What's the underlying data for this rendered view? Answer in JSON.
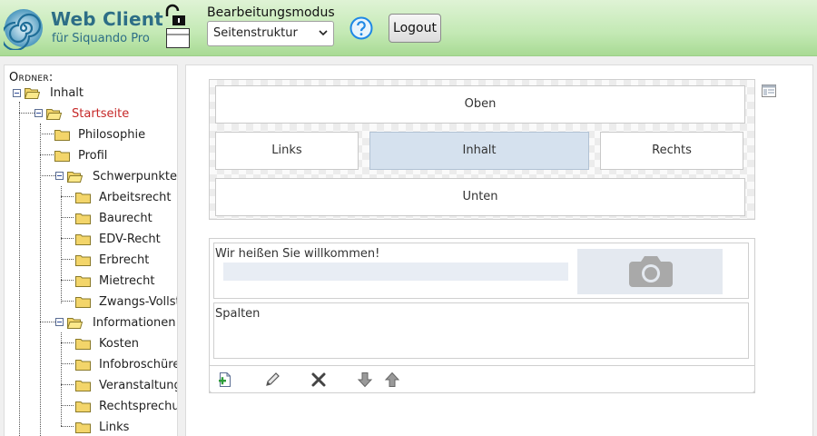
{
  "header": {
    "app_title": "Web Client",
    "app_subtitle": "für Siquando Pro",
    "mode_label": "Bearbeitungsmodus",
    "mode_value": "Seitenstruktur",
    "logout_label": "Logout"
  },
  "sidebar": {
    "title": "Ordner:",
    "tree": [
      {
        "label": "Inhalt",
        "toggle": "expanded"
      },
      {
        "label": "Startseite",
        "toggle": "expanded",
        "active": true
      },
      {
        "label": "Philosophie"
      },
      {
        "label": "Profil"
      },
      {
        "label": "Schwerpunkte",
        "toggle": "expanded"
      },
      {
        "label": "Arbeitsrecht"
      },
      {
        "label": "Baurecht"
      },
      {
        "label": "EDV-Recht"
      },
      {
        "label": "Erbrecht"
      },
      {
        "label": "Mietrecht"
      },
      {
        "label": "Zwangs-Vollstreckung"
      },
      {
        "label": "Informationen",
        "toggle": "expanded"
      },
      {
        "label": "Kosten"
      },
      {
        "label": "Infobroschüren"
      },
      {
        "label": "Veranstaltungen"
      },
      {
        "label": "Rechtsprechung"
      },
      {
        "label": "Links"
      }
    ]
  },
  "layout": {
    "top": "Oben",
    "left": "Links",
    "content": "Inhalt",
    "right": "Rechts",
    "bottom": "Unten",
    "selected": "content"
  },
  "content_blocks": [
    {
      "title": "Wir heißen Sie willkommen!",
      "type": "text-image"
    },
    {
      "title": "Spalten",
      "type": "columns"
    }
  ],
  "actions": [
    {
      "icon": "add-page-icon"
    },
    {
      "icon": "pencil-icon"
    },
    {
      "icon": "delete-x-icon"
    },
    {
      "icon": "arrow-down-icon"
    },
    {
      "icon": "arrow-up-icon"
    }
  ],
  "colors": {
    "header_green": "#c3e9b4",
    "brand_blue": "#2d6e86",
    "active_red": "#c62828",
    "selected_slot": "#d5e1ee",
    "help_blue": "#1e88e5"
  }
}
